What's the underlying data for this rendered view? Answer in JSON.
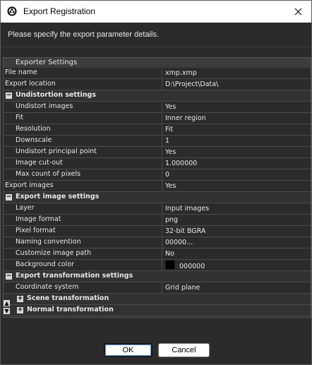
{
  "window": {
    "title": "Export Registration"
  },
  "description": "Please specify the export parameter details.",
  "group": {
    "label": "Exporter Settings"
  },
  "rows": [
    {
      "type": "prop",
      "indent": 0,
      "name": "File name",
      "value": "xmp.xmp"
    },
    {
      "type": "prop",
      "indent": 0,
      "name": "Export location",
      "value": "D:\\Project\\Data\\"
    },
    {
      "type": "cat",
      "indent": 0,
      "toggle": "minus",
      "name": "Undistortion settings"
    },
    {
      "type": "prop",
      "indent": 1,
      "name": "Undistort images",
      "value": "Yes"
    },
    {
      "type": "prop",
      "indent": 1,
      "name": "Fit",
      "value": "Inner region"
    },
    {
      "type": "prop",
      "indent": 1,
      "name": "Resolution",
      "value": "Fit"
    },
    {
      "type": "prop",
      "indent": 1,
      "name": "Downscale",
      "value": "1"
    },
    {
      "type": "prop",
      "indent": 1,
      "name": "Undistort principal point",
      "value": "Yes"
    },
    {
      "type": "prop",
      "indent": 1,
      "name": "Image cut-out",
      "value": "1.000000"
    },
    {
      "type": "prop",
      "indent": 1,
      "name": "Max count of pixels",
      "value": "0"
    },
    {
      "type": "prop",
      "indent": 0,
      "name": "Export images",
      "value": "Yes"
    },
    {
      "type": "cat",
      "indent": 0,
      "toggle": "minus",
      "name": "Export image settings"
    },
    {
      "type": "prop",
      "indent": 1,
      "name": "Layer",
      "value": "Input images"
    },
    {
      "type": "prop",
      "indent": 1,
      "name": "Image format",
      "value": "png"
    },
    {
      "type": "prop",
      "indent": 1,
      "name": "Pixel format",
      "value": "32-bit BGRA"
    },
    {
      "type": "prop",
      "indent": 1,
      "name": "Naming convention",
      "value": "00000..."
    },
    {
      "type": "prop",
      "indent": 1,
      "name": "Customize image path",
      "value": "No"
    },
    {
      "type": "color",
      "indent": 1,
      "name": "Background color",
      "value": "000000",
      "swatch": "#000000"
    },
    {
      "type": "cat",
      "indent": 0,
      "toggle": "minus",
      "name": "Export transformation settings"
    },
    {
      "type": "prop",
      "indent": 1,
      "name": "Coordinate system",
      "value": "Grid plane"
    },
    {
      "type": "cat",
      "indent": 1,
      "toggle": "plus",
      "name": "Scene transformation"
    },
    {
      "type": "cat",
      "indent": 1,
      "toggle": "plus",
      "name": "Normal transformation"
    }
  ],
  "buttons": {
    "ok": "OK",
    "cancel": "Cancel"
  },
  "icons": {
    "app": "aperture-icon",
    "close": "close-icon"
  },
  "colors": {
    "background": "#2b2b2b",
    "titlebar": "#ffffff",
    "grid_line": "#4a4a4a",
    "accent": "#5a9ad6"
  }
}
